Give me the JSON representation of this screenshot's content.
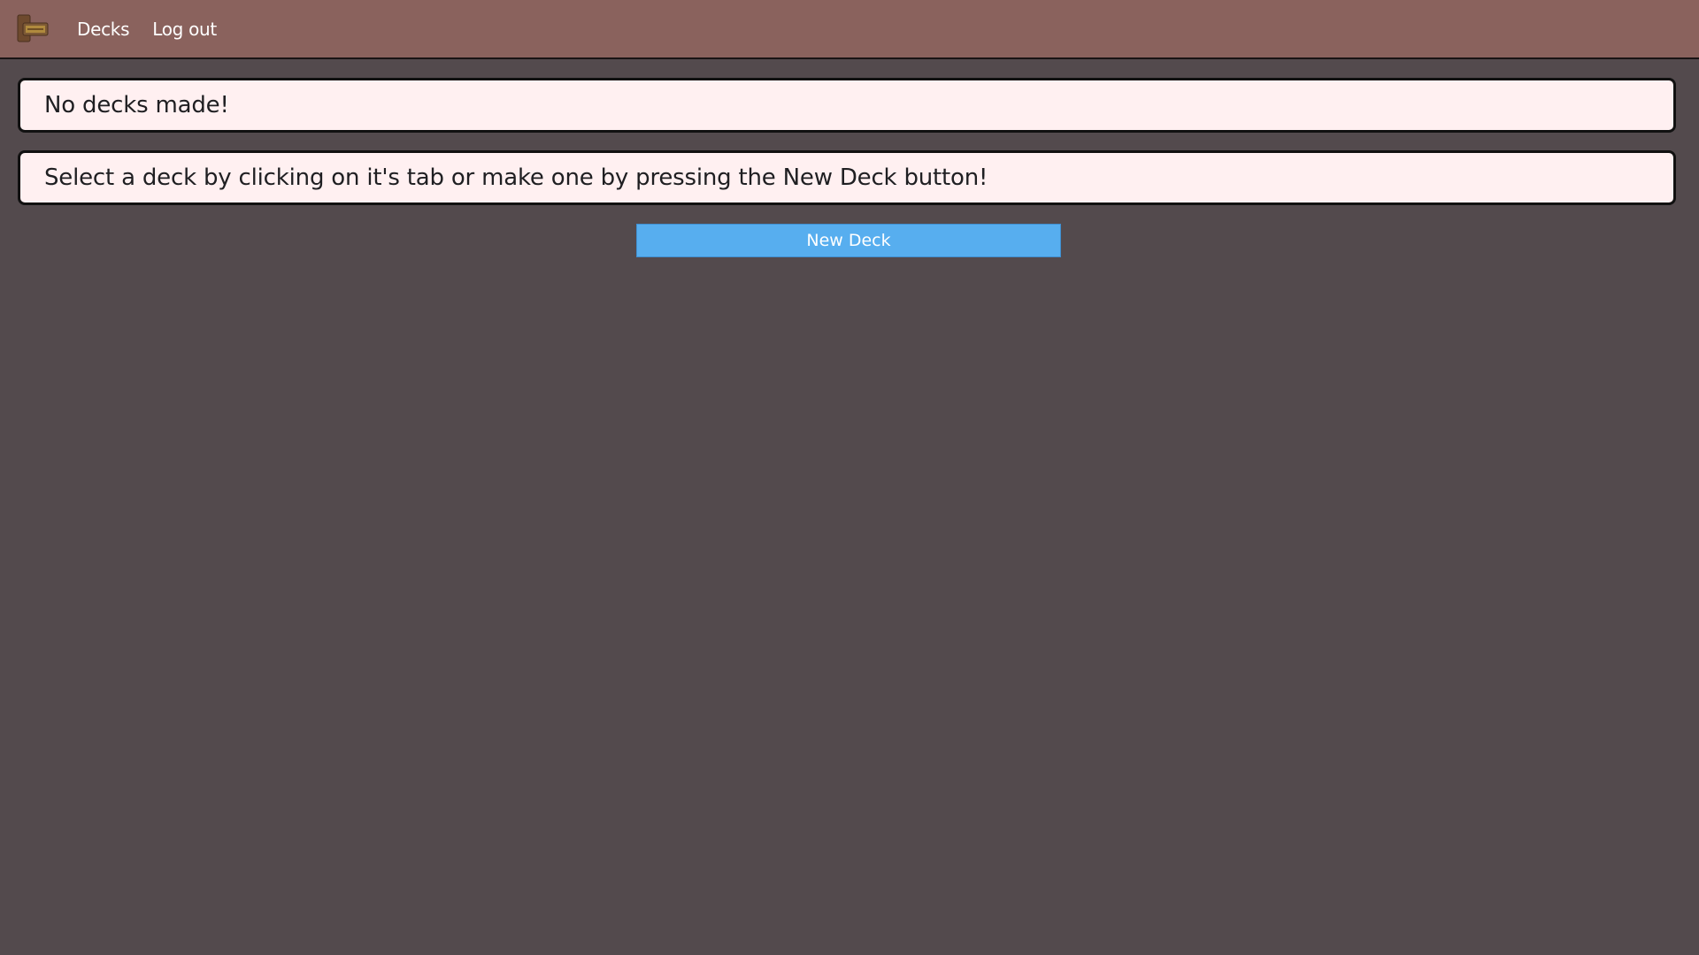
{
  "nav": {
    "logo_icon": "deck-box-logo-icon",
    "links": [
      {
        "label": "Decks"
      },
      {
        "label": "Log out"
      }
    ]
  },
  "messages": {
    "no_decks": "No decks made!",
    "instruction": "Select a deck by clicking on it's tab or make one by pressing the New Deck button!"
  },
  "actions": {
    "new_deck_label": "New Deck"
  },
  "colors": {
    "navbar": "#8a625d",
    "background": "#534a4d",
    "panel": "#fff0f1",
    "button": "#57aeef"
  }
}
